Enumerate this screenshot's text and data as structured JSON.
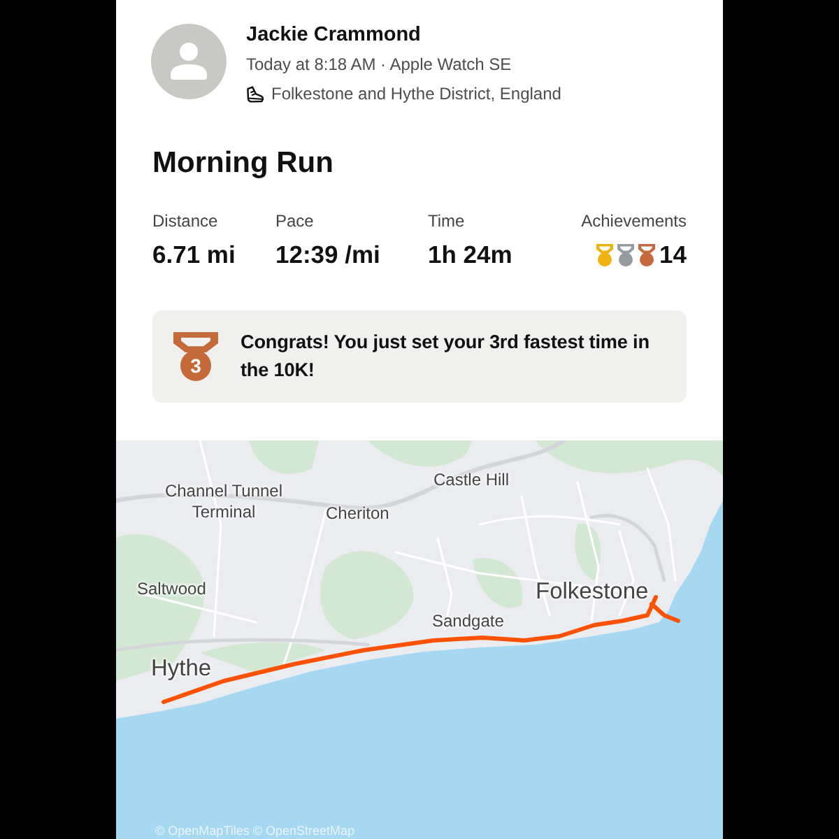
{
  "athlete": {
    "name": "Jackie Crammond",
    "meta": "Today at 8:18 AM · Apple Watch SE",
    "location": "Folkestone and Hythe District, England"
  },
  "activity": {
    "title": "Morning Run"
  },
  "stats": [
    {
      "kind": "metric",
      "label": "Distance",
      "value": "6.71 mi"
    },
    {
      "kind": "metric",
      "label": "Pace",
      "value": "12:39 /mi"
    },
    {
      "kind": "metric",
      "label": "Time",
      "value": "1h 24m"
    },
    {
      "kind": "achievements",
      "label": "Achievements",
      "value": "14",
      "medals": [
        {
          "color": "#efb20f"
        },
        {
          "color": "#959ba0"
        },
        {
          "color": "#c46a3d"
        }
      ]
    }
  ],
  "highlight": {
    "medal_label": "3",
    "text": "Congrats! You just set your 3rd fastest time in the 10K!"
  },
  "map": {
    "labels": [
      {
        "kind": "village",
        "text": "Castle Hill"
      },
      {
        "kind": "village",
        "text": "Channel Tunnel Terminal"
      },
      {
        "kind": "village",
        "text": "Cheriton"
      },
      {
        "kind": "village",
        "text": "Saltwood"
      },
      {
        "kind": "town",
        "text": "Folkestone"
      },
      {
        "kind": "village",
        "text": "Sandgate"
      },
      {
        "kind": "town",
        "text": "Hythe"
      }
    ],
    "attribution": "© OpenMapTiles © OpenStreetMap"
  }
}
